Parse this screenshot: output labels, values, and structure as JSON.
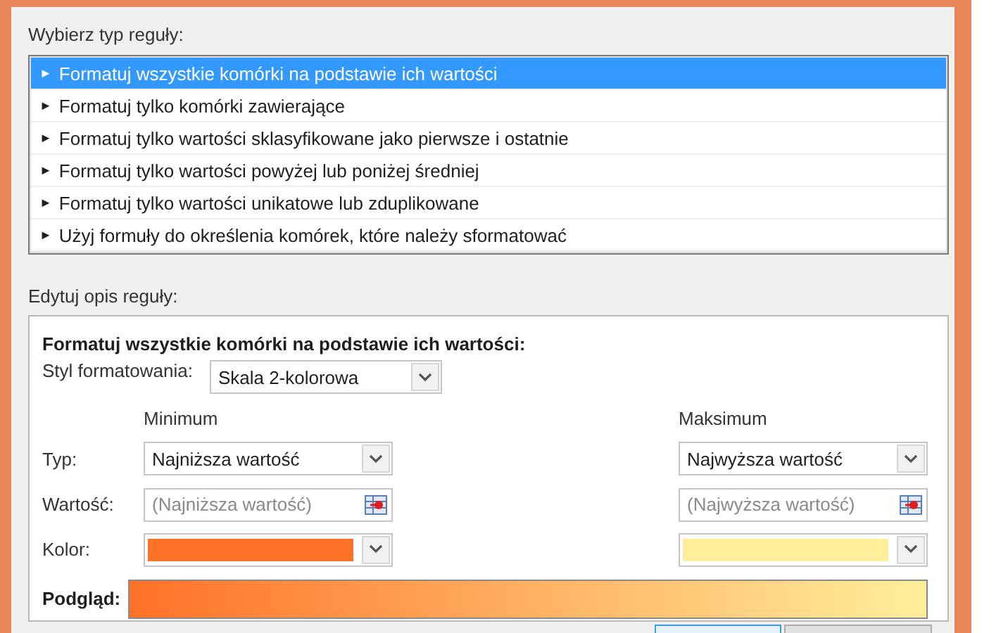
{
  "rule_type": {
    "label": "Wybierz typ reguły:",
    "items": [
      {
        "marker": "►",
        "label": "Formatuj wszystkie komórki na podstawie ich wartości",
        "selected": true
      },
      {
        "marker": "►",
        "label": "Formatuj tylko komórki zawierające",
        "selected": false
      },
      {
        "marker": "►",
        "label": "Formatuj tylko wartości sklasyfikowane jako pierwsze i ostatnie",
        "selected": false
      },
      {
        "marker": "►",
        "label": "Formatuj tylko wartości powyżej lub poniżej średniej",
        "selected": false
      },
      {
        "marker": "►",
        "label": "Formatuj tylko wartości unikatowe lub zduplikowane",
        "selected": false
      },
      {
        "marker": "►",
        "label": "Użyj formuły do określenia komórek, które należy sformatować",
        "selected": false
      }
    ]
  },
  "rule_description": {
    "label": "Edytuj opis reguły:",
    "title": "Formatuj wszystkie komórki na podstawie ich wartości:",
    "format_style": {
      "label": "Styl formatowania:",
      "value": "Skala 2-kolorowa"
    },
    "row_labels": [
      {
        "label": "Typ:"
      },
      {
        "label": "Wartość:"
      },
      {
        "label": "Kolor:"
      }
    ],
    "minimum": {
      "heading": "Minimum",
      "type": "Najniższa wartość",
      "placeholder": "(Najniższa wartość)",
      "color": "#ff7128"
    },
    "maximum": {
      "heading": "Maksimum",
      "type": "Najwyższa wartość",
      "placeholder": "(Najwyższa wartość)",
      "color": "#ffef9c"
    },
    "preview": {
      "label": "Podgląd:"
    }
  },
  "buttons": [
    {
      "default": true
    },
    {
      "default": false
    }
  ]
}
